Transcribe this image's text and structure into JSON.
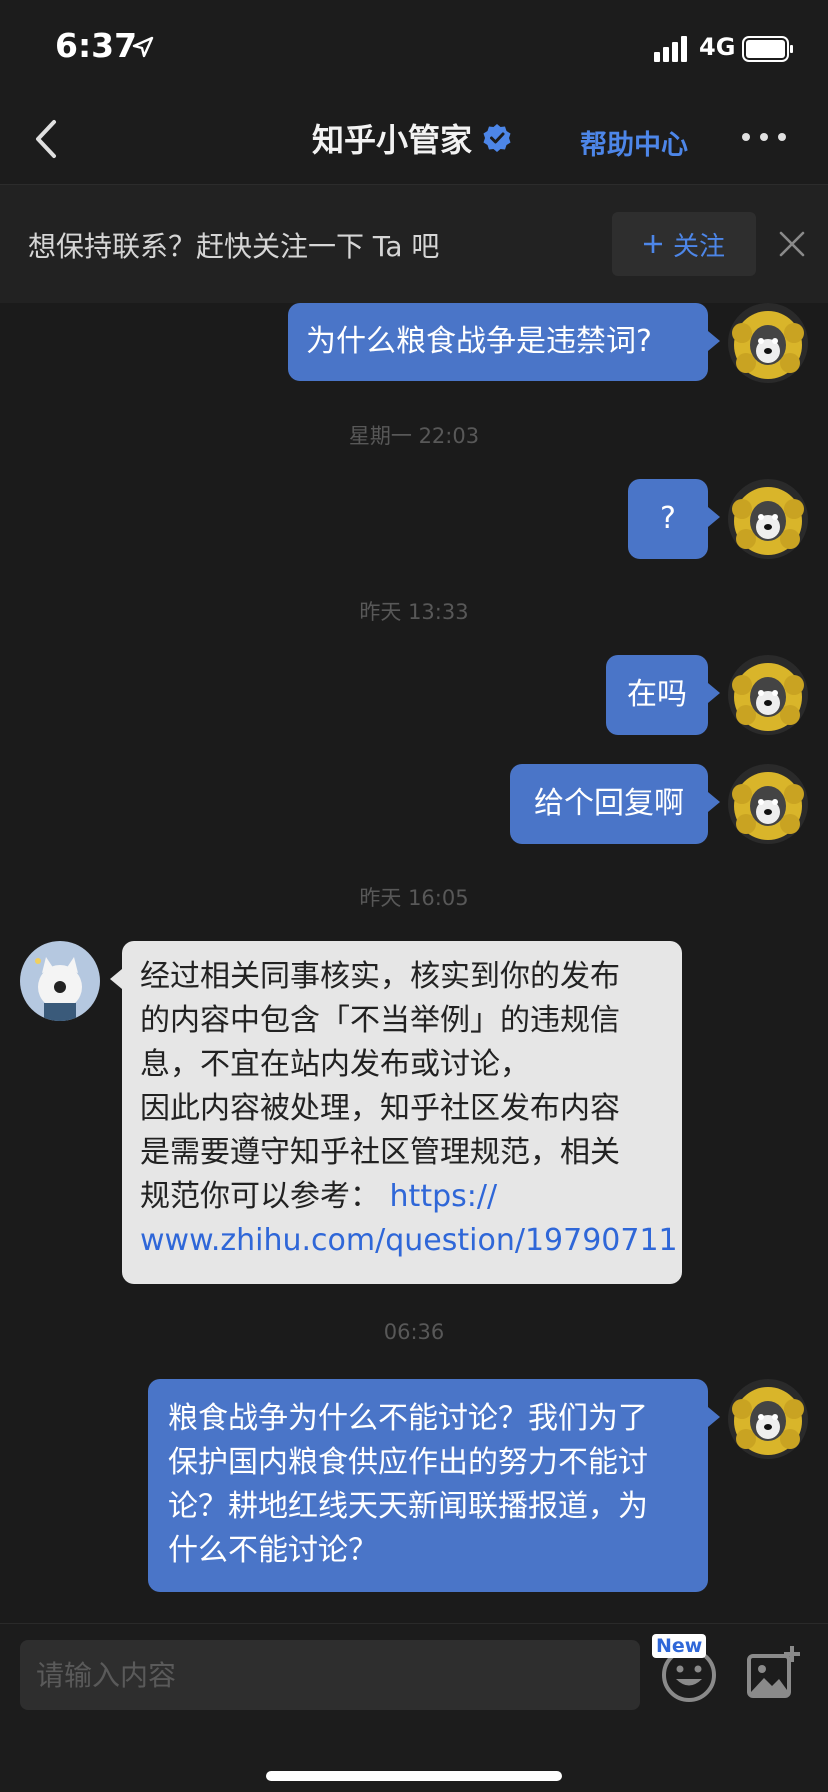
{
  "status_bar": {
    "time": "6:37",
    "network": "4G",
    "icons": [
      "location-arrow-icon",
      "signal-icon",
      "battery-icon"
    ]
  },
  "nav": {
    "title": "知乎小管家",
    "help": "帮助中心",
    "icons": [
      "back-arrow-icon",
      "verified-badge-icon",
      "more-icon"
    ]
  },
  "follow_banner": {
    "text": "想保持联系？赶快关注一下 Ta 吧",
    "button": "关注",
    "icons": [
      "plus-icon",
      "close-icon"
    ]
  },
  "messages": {
    "m1": "为什么粮食战争是违禁词?",
    "t1": "星期一 22:03",
    "m2": "?",
    "t2": "昨天 13:33",
    "m3": "在吗",
    "m4": "给个回复啊",
    "t3": "昨天 16:05",
    "reply": {
      "line1": "经过相关同事核实，核实到你的发布",
      "line2": "的内容中包含「不当举例」的违规信",
      "line3": "息，不宜在站内发布或讨论，",
      "line4": "因此内容被处理，知乎社区发布内容",
      "line5": "是需要遵守知乎社区管理规范，相关",
      "line6_text": "规范你可以参考：",
      "link_part1": "https://",
      "link_part2": "www.zhihu.com/question/19790711"
    },
    "t4": "06:36",
    "m5": {
      "line1": "粮食战争为什么不能讨论？我们为了",
      "line2": "保护国内粮食供应作出的努力不能讨",
      "line3": "论？耕地红线天天新闻联播报道，为",
      "line4": "什么不能讨论？"
    }
  },
  "input": {
    "placeholder": "请输入内容",
    "badge": "New",
    "icons": [
      "emoji-icon",
      "add-image-icon"
    ]
  },
  "colors": {
    "accent": "#4d86e8",
    "bubble_out": "#4a75c8",
    "bubble_in": "#e6e6e6",
    "background": "#1b1b1b"
  }
}
